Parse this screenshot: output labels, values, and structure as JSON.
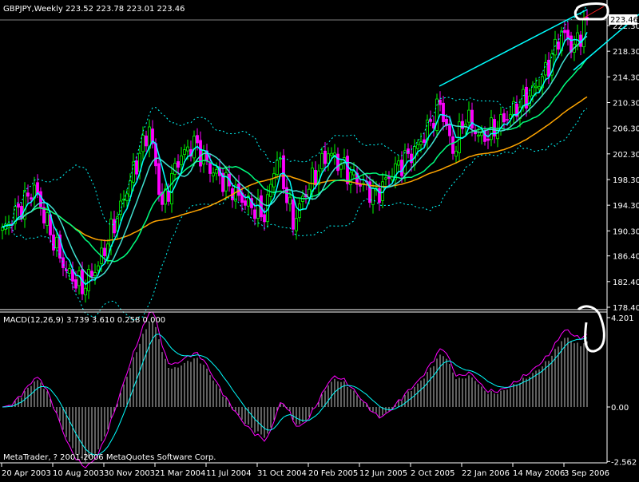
{
  "header": {
    "symbol_title": "GBPJPY,Weekly",
    "ohlc": "223.52 223.78 223.01 223.46"
  },
  "macd_header": "MACD(12,26,9) 3.739 3.610 0.258 0.000",
  "copyright": "MetaTrader, ? 2001-2006 MetaQuotes Software Corp.",
  "current_price_label": "223.46",
  "colors": {
    "background": "#000000",
    "bull": "#00ff00",
    "bear": "#ff00ff",
    "ma_fast": "#00ffff",
    "ma_mid": "#40e0d0",
    "ma_21": "#00ff7f",
    "ma_50": "#ffa500",
    "bands": "#00ffff",
    "macd_line": "#ff00ff",
    "signal_line": "#00ffff",
    "histogram": "#c0c0c0",
    "trendline": "#00ffff",
    "annotation": "#ffffff"
  },
  "chart_data": {
    "type": "candlestick",
    "title": "GBPJPY,Weekly",
    "price_ticks": [
      "222.30",
      "218.30",
      "214.30",
      "210.30",
      "206.30",
      "202.30",
      "198.30",
      "194.30",
      "190.30",
      "186.40",
      "182.40",
      "178.40"
    ],
    "price_range": [
      178.0,
      225.5
    ],
    "macd_ticks": [
      "4.201",
      "0.00",
      "-2.562"
    ],
    "macd_range": [
      -2.6,
      4.25
    ],
    "x_labels": [
      "20 Apr 2003",
      "10 Aug 2003",
      "30 Nov 2003",
      "21 Mar 2004",
      "11 Jul 2004",
      "31 Oct 2004",
      "20 Feb 2005",
      "12 Jun 2005",
      "2 Oct 2005",
      "22 Jan 2006",
      "14 May 2006",
      "3 Sep 2006"
    ],
    "weeks_per_label": 16,
    "total_weeks": 184,
    "close_waypoints_week_price": [
      [
        0,
        190.2
      ],
      [
        10,
        197.0
      ],
      [
        15,
        190.0
      ],
      [
        20,
        184.0
      ],
      [
        25,
        181.5
      ],
      [
        30,
        185.0
      ],
      [
        37,
        194.0
      ],
      [
        46,
        206.4
      ],
      [
        50,
        194.0
      ],
      [
        55,
        201.4
      ],
      [
        60,
        204.0
      ],
      [
        65,
        200.0
      ],
      [
        70,
        197.7
      ],
      [
        75,
        195.2
      ],
      [
        82,
        192.7
      ],
      [
        86,
        202.0
      ],
      [
        91,
        191.5
      ],
      [
        95,
        196.4
      ],
      [
        102,
        202.6
      ],
      [
        107,
        200.0
      ],
      [
        112,
        197.7
      ],
      [
        117,
        195.8
      ],
      [
        122,
        199.5
      ],
      [
        130,
        203.3
      ],
      [
        137,
        210.1
      ],
      [
        141,
        202.6
      ],
      [
        145,
        208.2
      ],
      [
        150,
        204.5
      ],
      [
        157,
        207.6
      ],
      [
        165,
        211.4
      ],
      [
        170,
        215.0
      ],
      [
        175,
        221.3
      ],
      [
        179,
        218.8
      ],
      [
        183,
        223.46
      ]
    ],
    "indicators": [
      "MA 5",
      "MA 10",
      "MA 21",
      "MA 50",
      "Bollinger Bands (20,2)",
      "MACD(12,26,9)"
    ]
  }
}
